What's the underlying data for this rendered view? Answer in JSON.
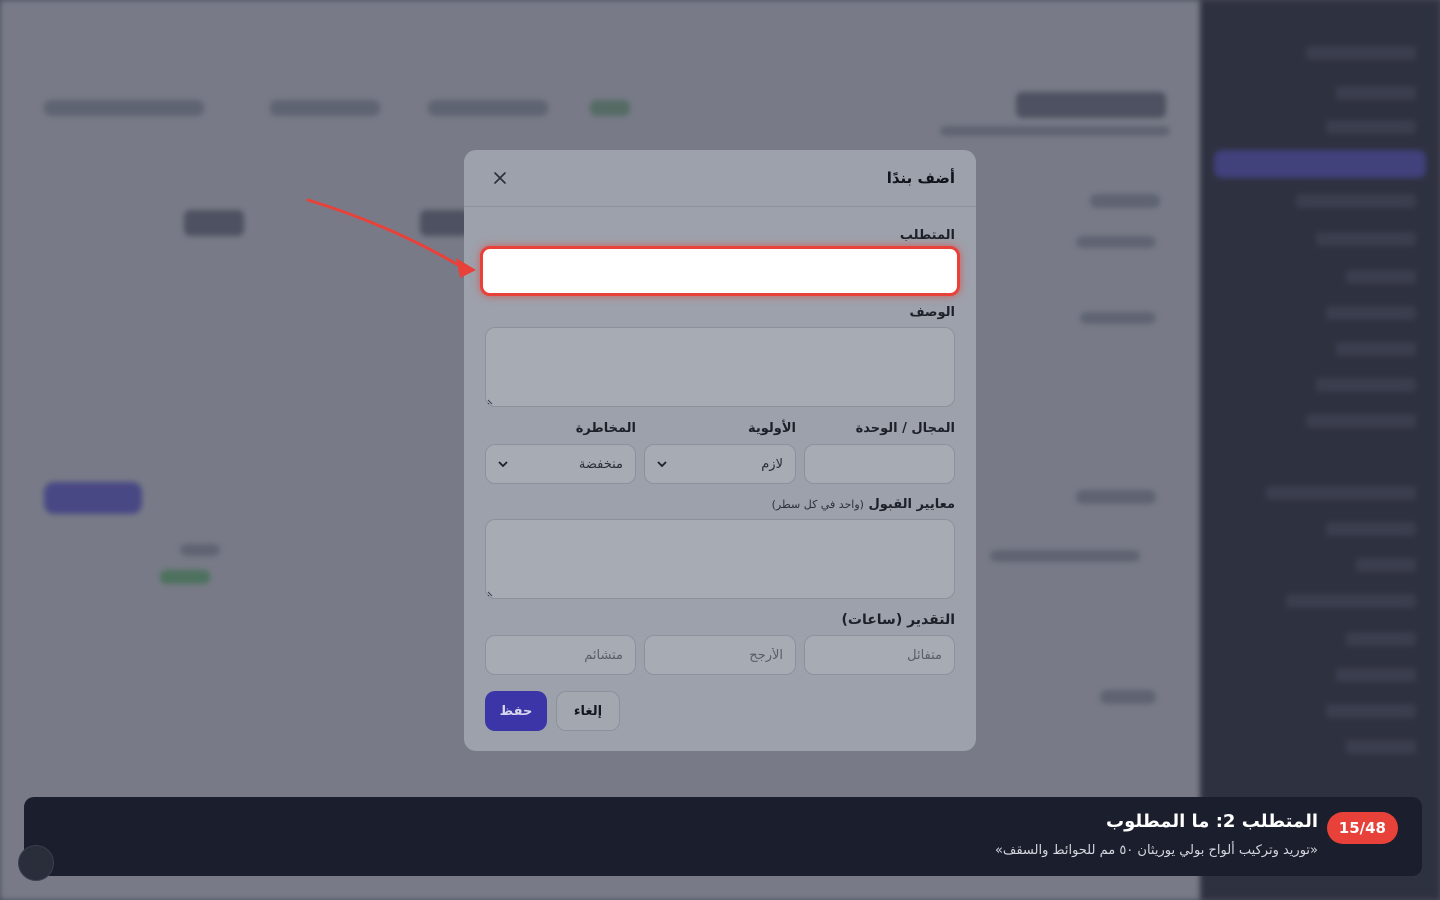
{
  "dialog": {
    "title": "أضف بندًا",
    "requirement_label": "المتطلب",
    "requirement_value": "",
    "description_label": "الوصف",
    "domain_label": "المجال / الوحدة",
    "priority_label": "الأولوية",
    "priority_value": "لازم",
    "risk_label": "المخاطرة",
    "risk_value": "منخفضة",
    "acceptance_label": "معايير القبول",
    "acceptance_hint": "(واحد في كل سطر)",
    "estimate_label": "التقدير (ساعات)",
    "optimistic_placeholder": "متفائل",
    "likely_placeholder": "الأرجح",
    "pessimistic_placeholder": "متشائم",
    "save_label": "حفظ",
    "cancel_label": "إلغاء"
  },
  "banner": {
    "step": "15/48",
    "title": "المتطلب 2: ما المطلوب",
    "subtitle": "«توريد وتركيب ألواح بولي يوريثان ٥٠ مم للحوائط والسقف»"
  },
  "colors": {
    "accent_red": "#e8413a",
    "primary": "#3b35a8",
    "banner_bg": "#1b1e2c"
  }
}
